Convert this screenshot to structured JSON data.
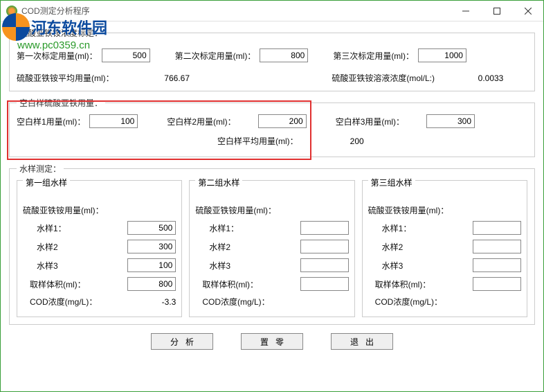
{
  "window": {
    "title": "COD测定分析程序"
  },
  "watermark": {
    "name": "河东软件园",
    "url": "www.pc0359.cn"
  },
  "calibration": {
    "legend": "硫酸亚铁铵浓度标定：",
    "c1_label": "第一次标定用量(ml)：",
    "c1_value": "500",
    "c2_label": "第二次标定用量(ml)：",
    "c2_value": "800",
    "c3_label": "第三次标定用量(ml)：",
    "c3_value": "1000",
    "avg_label": "硫酸亚铁铵平均用量(ml)：",
    "avg_value": "766.67",
    "conc_label": "硫酸亚铁铵溶液浓度(mol/L:)",
    "conc_value": "0.0033"
  },
  "blank": {
    "legend": "空白样硫酸亚铁用量：",
    "b1_label": "空白样1用量(ml)：",
    "b1_value": "100",
    "b2_label": "空白样2用量(ml)：",
    "b2_value": "200",
    "b3_label": "空白样3用量(ml)：",
    "b3_value": "300",
    "avg_label": "空白样平均用量(ml)：",
    "avg_value": "200"
  },
  "samples": {
    "legend": "水样测定：",
    "fas_label": "硫酸亚铁铵用量(ml)：",
    "s1_label": "水样1：",
    "s2_label": "水样2",
    "s3_label": "水样3",
    "vol_label": "取样体积(ml)：",
    "cod_label": "COD浓度(mg/L)：",
    "groups": [
      {
        "title": "第一组水样",
        "s1": "500",
        "s2": "300",
        "s3": "100",
        "vol": "800",
        "cod": "-3.3"
      },
      {
        "title": "第二组水样",
        "s1": "",
        "s2": "",
        "s3": "",
        "vol": "",
        "cod": ""
      },
      {
        "title": "第三组水样",
        "s1": "",
        "s2": "",
        "s3": "",
        "vol": "",
        "cod": ""
      }
    ]
  },
  "buttons": {
    "analyze": "分析",
    "reset": "置零",
    "exit": "退出"
  }
}
